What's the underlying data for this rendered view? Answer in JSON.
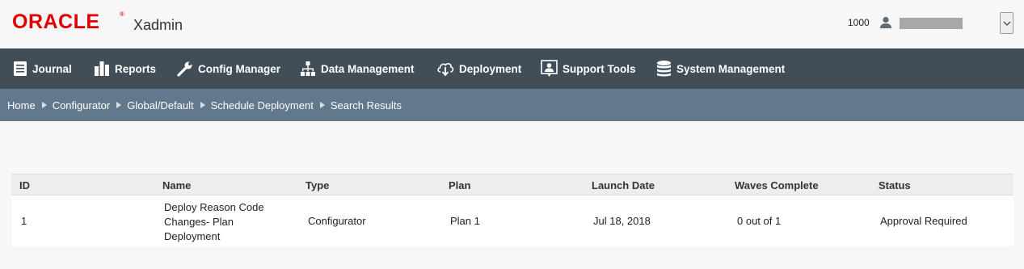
{
  "header": {
    "logo_text": "ORACLE",
    "logo_mark": "®",
    "app_name": "Xadmin",
    "org_id": "1000",
    "user_icon": "user-icon",
    "user_menu_icon": "chevron-down-icon"
  },
  "nav": {
    "items": [
      {
        "label": "Journal",
        "icon": "journal-icon"
      },
      {
        "label": "Reports",
        "icon": "bar-chart-icon"
      },
      {
        "label": "Config Manager",
        "icon": "wrench-icon"
      },
      {
        "label": "Data Management",
        "icon": "hierarchy-icon"
      },
      {
        "label": "Deployment",
        "icon": "cloud-download-icon"
      },
      {
        "label": "Support Tools",
        "icon": "support-person-icon"
      },
      {
        "label": "System Management",
        "icon": "database-icon"
      }
    ]
  },
  "breadcrumb": [
    "Home",
    "Configurator",
    "Global/Default",
    "Schedule Deployment",
    "Search Results"
  ],
  "table": {
    "columns": [
      "ID",
      "Name",
      "Type",
      "Plan",
      "Launch Date",
      "Waves Complete",
      "Status"
    ],
    "rows": [
      {
        "id": "1",
        "name_lines": [
          "Deploy Reason Code",
          "Changes- Plan",
          "Deployment"
        ],
        "type": "Configurator",
        "plan": "Plan 1",
        "launch_date": "Jul 18, 2018",
        "waves_complete": "0 out of 1",
        "status": "Approval Required"
      }
    ]
  },
  "colors": {
    "brand_red": "#e00000",
    "nav_bg": "#414e57",
    "breadcrumb_bg": "#62798d"
  }
}
